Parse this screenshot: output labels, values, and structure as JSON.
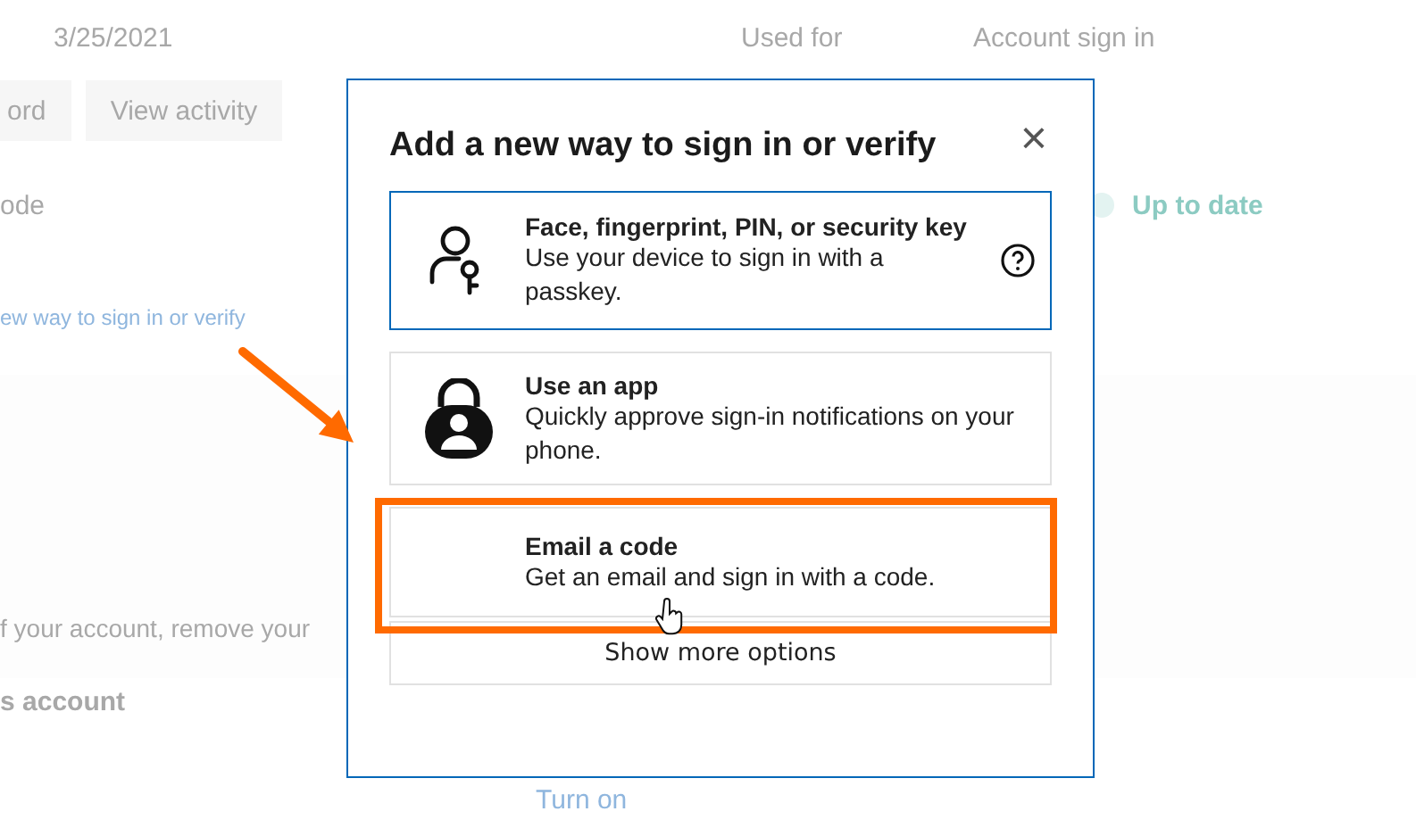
{
  "background": {
    "date": "3/25/2021",
    "used_for_label": "Used for",
    "used_for_value": "Account sign in",
    "buttons": [
      "ord",
      "View activity"
    ],
    "method_label": "ode",
    "status": "Up to date",
    "add_link": "ew way to sign in or verify",
    "description": "f your account, remove your",
    "section_title": "s account",
    "turn_on_link": "Turn on"
  },
  "dialog": {
    "title": "Add a new way to sign in or verify",
    "close": "×",
    "options": [
      {
        "kind": "key",
        "title": "Face, fingerprint, PIN, or security key",
        "description": "Use your device to sign in with a passkey.",
        "help": true,
        "selected": true
      },
      {
        "kind": "app",
        "title": "Use an app",
        "description": "Quickly approve sign-in notifications on your phone.",
        "help": false,
        "selected": false
      },
      {
        "kind": "email",
        "title": "Email a code",
        "description": "Get an email and sign in with a code.",
        "help": false,
        "selected": false
      }
    ],
    "more": "Show more options"
  }
}
